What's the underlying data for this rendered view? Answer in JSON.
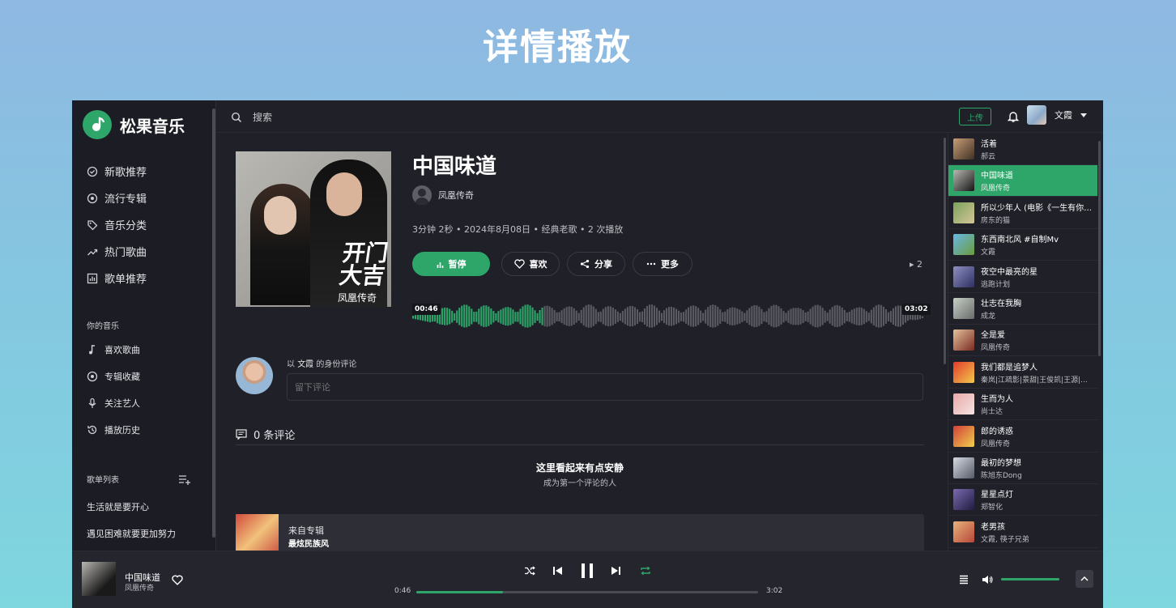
{
  "banner": "详情播放",
  "app": {
    "name": "松果音乐"
  },
  "nav": {
    "items": [
      {
        "label": "新歌推荐",
        "icon": "badge-check-icon"
      },
      {
        "label": "流行专辑",
        "icon": "disc-icon"
      },
      {
        "label": "音乐分类",
        "icon": "tag-icon"
      },
      {
        "label": "热门歌曲",
        "icon": "trending-icon"
      },
      {
        "label": "歌单推荐",
        "icon": "chart-icon"
      }
    ],
    "your_music_title": "你的音乐",
    "your_music": [
      {
        "label": "喜欢歌曲",
        "icon": "music-note-icon"
      },
      {
        "label": "专辑收藏",
        "icon": "disc-icon"
      },
      {
        "label": "关注艺人",
        "icon": "microphone-icon"
      },
      {
        "label": "播放历史",
        "icon": "history-icon"
      }
    ],
    "playlist_title": "歌单列表",
    "playlists": [
      "生活就是要开心",
      "遇见困难就要更加努力"
    ]
  },
  "topbar": {
    "search_placeholder": "搜索",
    "upload": "上传",
    "username": "文霞"
  },
  "song": {
    "title": "中国味道",
    "artist": "凤凰传奇",
    "meta": "3分钟 2秒 • 2024年8月08日 • 经典老歌 • 2 次播放",
    "cover_text": "开门大吉",
    "cover_sub": "凤凰传奇",
    "queue_count": "▸ 2",
    "wave_current": "00:46",
    "wave_total": "03:02",
    "progress": 0.253
  },
  "actions": {
    "pause": "暂停",
    "like": "喜欢",
    "share": "分享",
    "more": "更多"
  },
  "comments": {
    "as_prefix": "以",
    "as_user": "文霞",
    "as_suffix": "的身份评论",
    "placeholder": "留下评论",
    "count": "0 条评论",
    "empty_title": "这里看起来有点安静",
    "empty_sub": "成为第一个评论的人"
  },
  "album": {
    "from": "来自专辑",
    "name": "最炫民族风"
  },
  "queue": [
    {
      "title": "活着",
      "artist": "郝云",
      "c1": "#c89d76",
      "c2": "#3f3125"
    },
    {
      "title": "中国味道",
      "artist": "凤凰传奇",
      "c1": "#b9b8b3",
      "c2": "#151515"
    },
    {
      "title": "所以少年人 (电影《一生有你》...",
      "artist": "房东的猫",
      "c1": "#7aa35b",
      "c2": "#d6c49a"
    },
    {
      "title": "东西南北风 #自制Mv",
      "artist": "文霞",
      "c1": "#68b8e6",
      "c2": "#6b9b3d"
    },
    {
      "title": "夜空中最亮的星",
      "artist": "逃跑计划",
      "c1": "#8f8ec4",
      "c2": "#2e3060"
    },
    {
      "title": "壮志在我胸",
      "artist": "成龙",
      "c1": "#c6d0c5",
      "c2": "#6b6b6b"
    },
    {
      "title": "全是爱",
      "artist": "凤凰传奇",
      "c1": "#e4c19b",
      "c2": "#7a2a22"
    },
    {
      "title": "我们都是追梦人",
      "artist": "秦岚|江疏影|景甜|王俊凯|王源|...",
      "c1": "#e23c2a",
      "c2": "#f1c94b"
    },
    {
      "title": "生而为人",
      "artist": "尚士达",
      "c1": "#e8a9a8",
      "c2": "#f5e4e2"
    },
    {
      "title": "郎的诱惑",
      "artist": "凤凰传奇",
      "c1": "#d23f3a",
      "c2": "#f0d04c"
    },
    {
      "title": "最初的梦想",
      "artist": "陈旭东Dong",
      "c1": "#d7dbe2",
      "c2": "#545a68"
    },
    {
      "title": "星星点灯",
      "artist": "郑智化",
      "c1": "#7c6ab0",
      "c2": "#1f1c40"
    },
    {
      "title": "老男孩",
      "artist": "文霞, 筷子兄弟",
      "c1": "#e9b37a",
      "c2": "#b6473a"
    }
  ],
  "player": {
    "title": "中国味道",
    "artist": "凤凰传奇",
    "current": "0:46",
    "total": "3:02",
    "progress": 0.253,
    "volume": 1.0
  },
  "colors": {
    "accent": "#2ea66a",
    "bg": "#1f2028",
    "sidebar": "#1c1d24"
  }
}
